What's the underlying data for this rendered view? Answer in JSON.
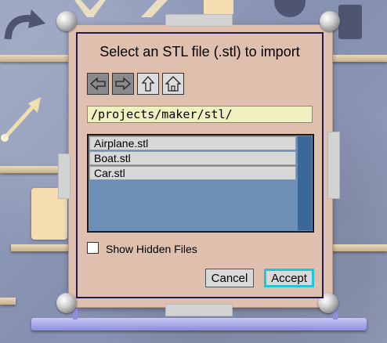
{
  "dialog": {
    "title": "Select an STL file (.stl) to import",
    "nav": {
      "back_icon": "arrow-left-icon",
      "forward_icon": "arrow-right-icon",
      "up_icon": "arrow-up-icon",
      "home_icon": "home-icon"
    },
    "path_value": "/projects/maker/stl/",
    "files": [
      "Airplane.stl",
      "Boat.stl",
      "Car.stl"
    ],
    "show_hidden_label": "Show Hidden Files",
    "show_hidden_checked": false,
    "cancel_label": "Cancel",
    "accept_label": "Accept"
  },
  "colors": {
    "dialog_bg": "#dfbfae",
    "dialog_border": "#1c1a55",
    "path_bg": "#f0f0c0",
    "list_bg": "#6d8fb6",
    "scrollbar": "#3a6898",
    "accept_focus": "#24c4d8",
    "rail": "#8e8de0"
  }
}
